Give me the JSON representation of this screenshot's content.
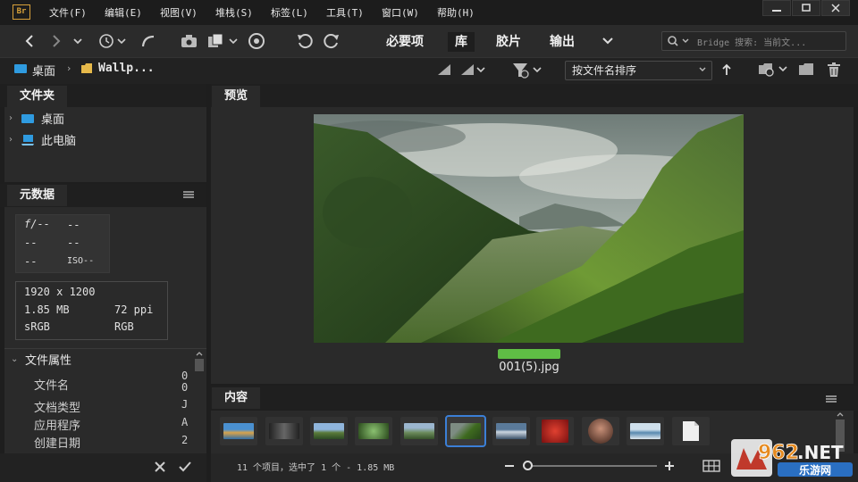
{
  "app": {
    "icon_label": "Br"
  },
  "menubar": {
    "items": [
      "文件(F)",
      "编辑(E)",
      "视图(V)",
      "堆栈(S)",
      "标签(L)",
      "工具(T)",
      "窗口(W)",
      "帮助(H)"
    ]
  },
  "toolbar": {
    "workspaces": [
      "必要项",
      "库",
      "胶片",
      "输出"
    ],
    "active_workspace": "库",
    "search_placeholder": "Bridge 搜索: 当前文..."
  },
  "pathbar": {
    "crumbs": [
      "桌面",
      "Wallp..."
    ],
    "sort_label": "按文件名排序"
  },
  "folders_panel": {
    "tab": "文件夹",
    "items": [
      "桌面",
      "此电脑"
    ]
  },
  "metadata_panel": {
    "tab": "元数据",
    "camera": {
      "aperture": "f/--",
      "shutter": "--",
      "row2a": "--",
      "row2b": "--",
      "row3a": "--",
      "iso": "ISO--"
    },
    "image": {
      "dimensions": "1920 x 1200",
      "size": "1.85 MB",
      "resolution": "72 ppi",
      "colorspace": "sRGB",
      "mode": "RGB"
    },
    "section_title": "文件属性",
    "properties": [
      {
        "label": "文件名",
        "value": "0"
      },
      {
        "label": "",
        "value": "0"
      },
      {
        "label": "文档类型",
        "value": "J"
      },
      {
        "label": "应用程序",
        "value": "A"
      },
      {
        "label": "创建日期",
        "value": "2"
      }
    ]
  },
  "preview_panel": {
    "tab": "预览",
    "file_name": "001(5).jpg"
  },
  "content_panel": {
    "tab": "内容",
    "status": "11 个项目，选中了 1 个 - 1.85 MB",
    "zoom_level": 0.0
  },
  "watermark": {
    "number": "962",
    "dotnet": ".NET",
    "sub": "乐游网"
  },
  "colors": {
    "accent": "#3b7fd6",
    "label_green": "#5fbd45",
    "app_icon": "#d8a13a"
  }
}
